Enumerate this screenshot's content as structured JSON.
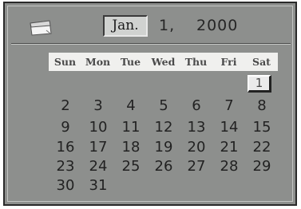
{
  "header": {
    "icon": "calendar-icon",
    "month": "Jan.",
    "day": "1,",
    "year": "2000"
  },
  "weekdays": [
    "Sun",
    "Mon",
    "Tue",
    "Wed",
    "Thu",
    "Fri",
    "Sat"
  ],
  "weeks": [
    [
      "",
      "",
      "",
      "",
      "",
      "",
      "1"
    ],
    [
      "2",
      "3",
      "4",
      "5",
      "6",
      "7",
      "8"
    ],
    [
      "9",
      "10",
      "11",
      "12",
      "13",
      "14",
      "15"
    ],
    [
      "16",
      "17",
      "18",
      "19",
      "20",
      "21",
      "22"
    ],
    [
      "23",
      "24",
      "25",
      "26",
      "27",
      "28",
      "29"
    ],
    [
      "30",
      "31",
      "",
      "",
      "",
      "",
      ""
    ]
  ],
  "selected_day": "1",
  "colors": {
    "panel": "#8d8f8d",
    "weekday_bar": "#f0f0ee",
    "text": "#222222"
  }
}
